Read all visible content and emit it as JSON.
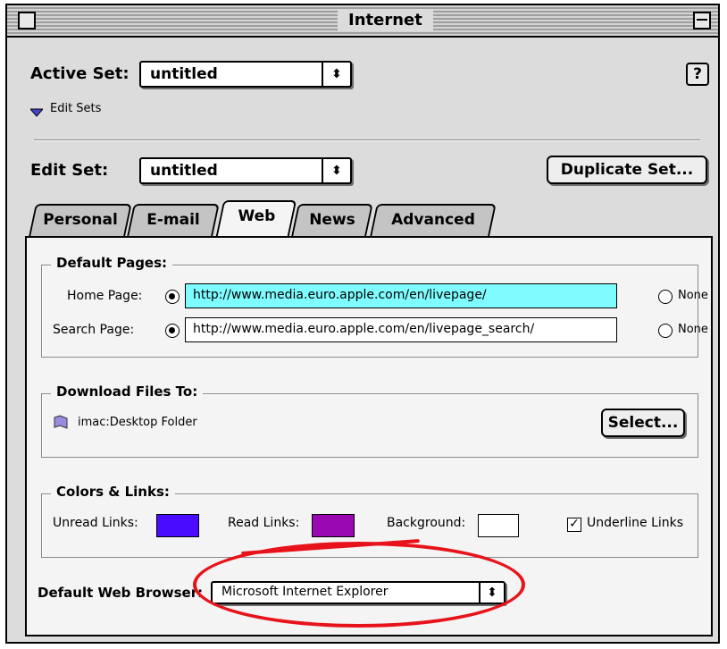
{
  "window": {
    "title": "Internet"
  },
  "header": {
    "active_set_label": "Active Set:",
    "active_set_value": "untitled",
    "help_label": "?",
    "edit_sets_label": "Edit Sets",
    "edit_set_label": "Edit Set:",
    "edit_set_value": "untitled",
    "duplicate_button": "Duplicate Set..."
  },
  "tabs": [
    {
      "label": "Personal",
      "active": false
    },
    {
      "label": "E-mail",
      "active": false
    },
    {
      "label": "Web",
      "active": true
    },
    {
      "label": "News",
      "active": false
    },
    {
      "label": "Advanced",
      "active": false
    }
  ],
  "default_pages": {
    "title": "Default Pages:",
    "home_label": "Home Page:",
    "home_value": "http://www.media.euro.apple.com/en/livepage/",
    "search_label": "Search Page:",
    "search_value": "http://www.media.euro.apple.com/en/livepage_search/",
    "none_label": "None"
  },
  "download": {
    "title": "Download Files To:",
    "folder": "imac:Desktop Folder",
    "select_button": "Select..."
  },
  "colors": {
    "title": "Colors & Links:",
    "unread_label": "Unread Links:",
    "unread_color": "#4a0cff",
    "read_label": "Read Links:",
    "read_color": "#9a08b4",
    "background_label": "Background:",
    "background_color": "#ffffff",
    "underline_label": "Underline Links",
    "underline_checked": true
  },
  "browser": {
    "label": "Default Web Browser:",
    "value": "Microsoft Internet Explorer"
  },
  "annotation": {
    "color": "#e8121a"
  },
  "icons": {
    "popup_arrow": "updown-arrow-icon",
    "triangle": "disclosure-triangle-icon",
    "folder": "folder-icon",
    "check": "checkmark-icon"
  }
}
